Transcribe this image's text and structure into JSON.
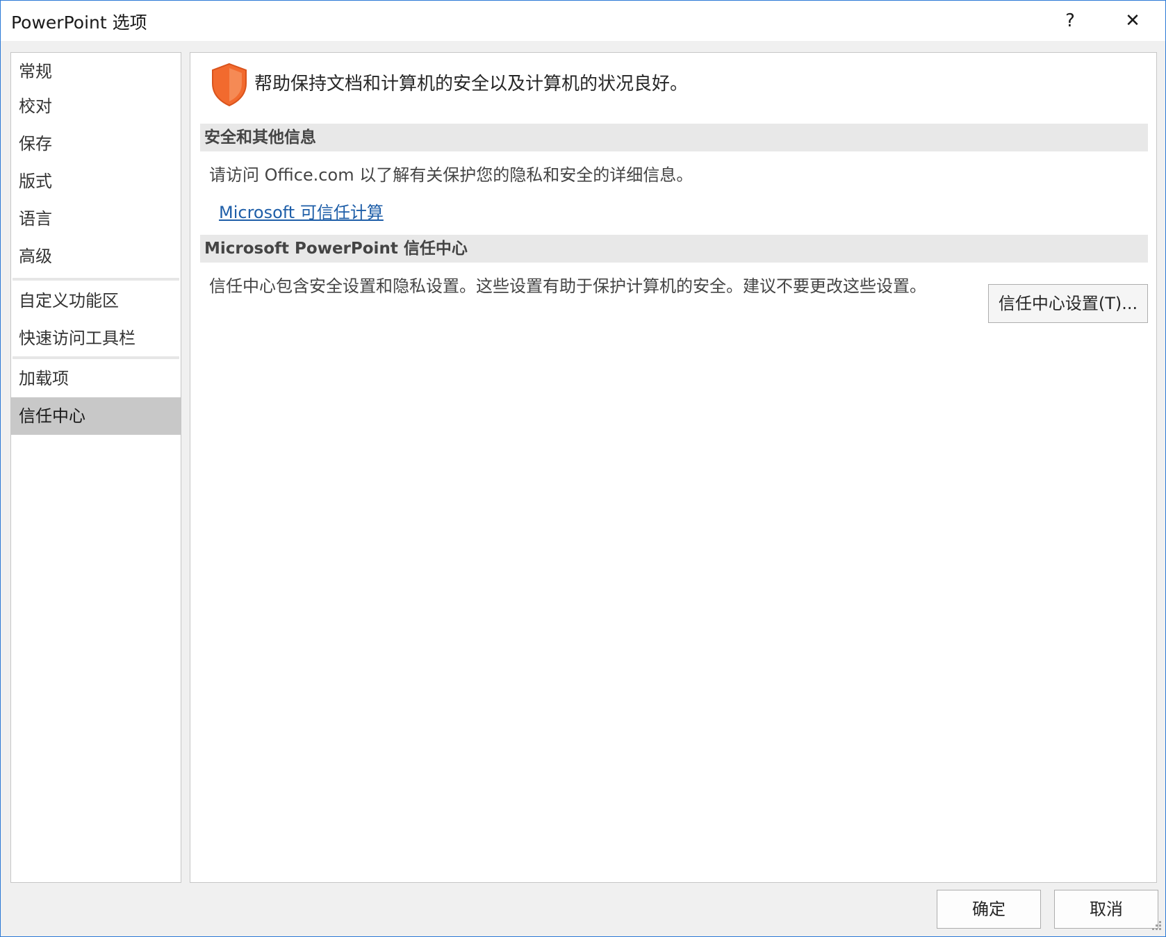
{
  "window": {
    "title": "PowerPoint 选项",
    "help_label": "?",
    "close_label": "✕"
  },
  "sidebar": {
    "items": [
      {
        "label": "常规",
        "selected": false
      },
      {
        "label": "校对",
        "selected": false
      },
      {
        "label": "保存",
        "selected": false
      },
      {
        "label": "版式",
        "selected": false
      },
      {
        "label": "语言",
        "selected": false
      },
      {
        "label": "高级",
        "selected": false
      },
      {
        "label": "自定义功能区",
        "selected": false
      },
      {
        "label": "快速访问工具栏",
        "selected": false
      },
      {
        "label": "加载项",
        "selected": false
      },
      {
        "label": "信任中心",
        "selected": true
      }
    ]
  },
  "main": {
    "intro": "帮助保持文档和计算机的安全以及计算机的状况良好。",
    "security_section": {
      "header": "安全和其他信息",
      "text": "请访问 Office.com 以了解有关保护您的隐私和安全的详细信息。",
      "link": "Microsoft 可信任计算"
    },
    "trust_center_section": {
      "header": "Microsoft PowerPoint 信任中心",
      "text": "信任中心包含安全设置和隐私设置。这些设置有助于保护计算机的安全。建议不要更改这些设置。",
      "button_label": "信任中心设置(T)..."
    }
  },
  "footer": {
    "ok_label": "确定",
    "cancel_label": "取消"
  },
  "colors": {
    "shield": "#f26a2e",
    "link": "#1e5ea8",
    "selected_nav": "#c8c8c8",
    "section_header_bg": "#e8e8e8"
  },
  "icons": {
    "shield": "shield-icon",
    "help": "help-icon",
    "close": "close-icon",
    "resize": "resize-grip-icon"
  }
}
